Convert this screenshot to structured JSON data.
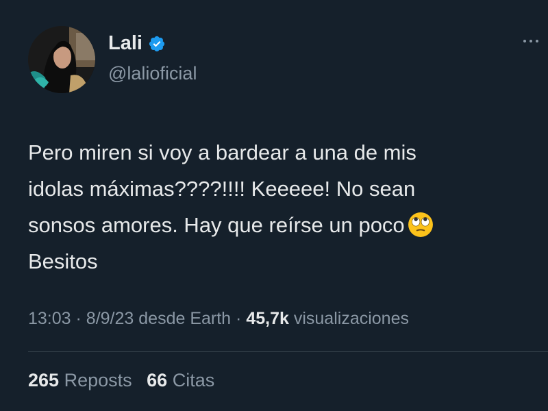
{
  "user": {
    "display_name": "Lali",
    "handle": "@lalioficial",
    "verified": true
  },
  "tweet": {
    "lines": [
      "Pero miren si voy a bardear a una de mis",
      "idolas máximas????!!!! Keeeee! No sean",
      "sonsos amores. Hay que reírse un poco",
      "Besitos"
    ],
    "emoji": "face-with-rolling-eyes"
  },
  "meta": {
    "time": "13:03",
    "date": "8/9/23",
    "source": "desde Earth",
    "separator": "·",
    "views_count": "45,7k",
    "views_label": "visualizaciones"
  },
  "stats": {
    "reposts_count": "265",
    "reposts_label": "Reposts",
    "quotes_count": "66",
    "quotes_label": "Citas"
  },
  "colors": {
    "background": "#15202b",
    "text_primary": "#e7e9ea",
    "text_secondary": "#8b98a5",
    "verified_blue": "#1d9bf0",
    "divider": "#38444d"
  }
}
